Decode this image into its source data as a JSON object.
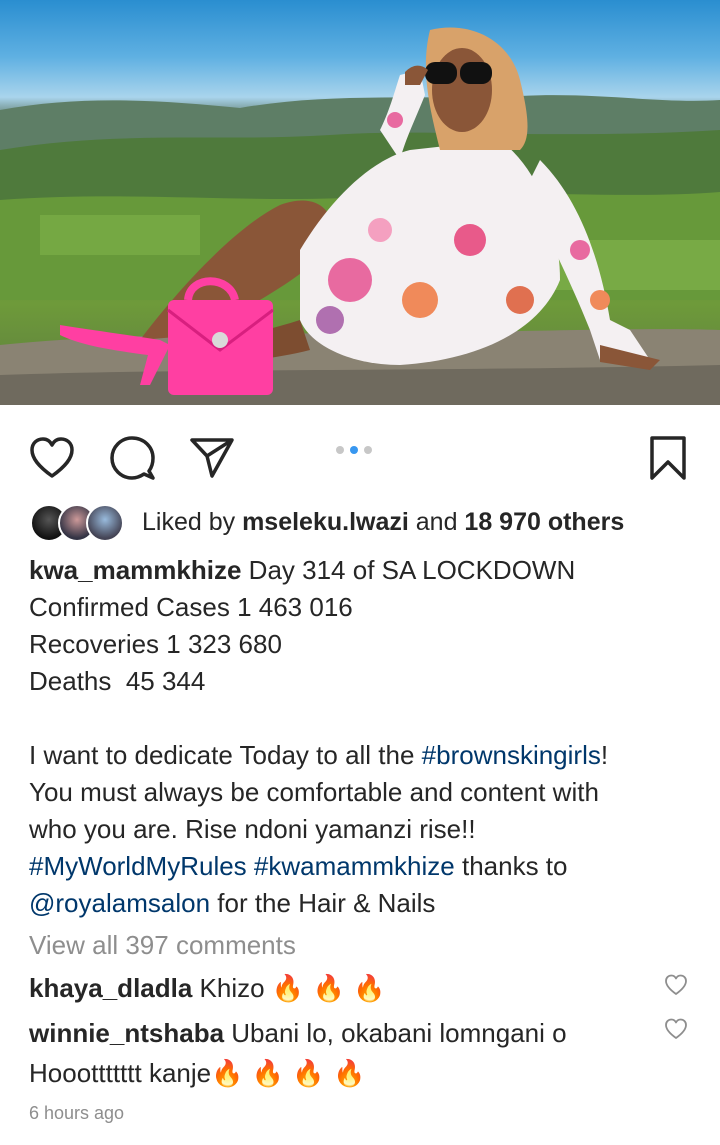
{
  "post": {
    "image_alt": "Woman in floral dress sitting on a rock with pink bag overlooking green valley",
    "carousel": {
      "count": 3,
      "active_index": 1
    }
  },
  "likes": {
    "prefix": "Liked by ",
    "user": "mseleku.lwazi",
    "middle": " and ",
    "others": "18 970 others"
  },
  "caption": {
    "author": "kwa_mammkhize",
    "line1_text": " Day 314 of SA LOCKDOWN",
    "line2": "Confirmed Cases 1 463 016",
    "line3": "Recoveries 1 323 680",
    "line4": "Deaths  45 344",
    "p2_line1_text": "I want to dedicate Today to all the ",
    "p2_line1_tag": "#brownskingirls",
    "p2_line1_end": "!",
    "p2_line2": "You must always be comfortable and content with",
    "p2_line3": "who you are. Rise ndoni yamanzi rise!!",
    "p2_line4_tag1": "#MyWorldMyRules",
    "p2_line4_space": " ",
    "p2_line4_tag2": "#kwamammkhize",
    "p2_line4_end": " thanks to",
    "p2_line5_tag": "@royalamsalon",
    "p2_line5_end": " for the Hair & Nails"
  },
  "view_all_comments": "View all 397 comments",
  "comments": [
    {
      "user": "khaya_dladla",
      "text": " Khizo ",
      "emoji": "🔥 🔥 🔥"
    },
    {
      "user": "winnie_ntshaba",
      "text": " Ubani lo, okabani lomngani o",
      "text2": "Hooottttttt kanje",
      "emoji": "🔥 🔥 🔥 🔥"
    }
  ],
  "timestamp": "6 hours ago",
  "colors": {
    "link": "#00376b",
    "muted": "#8e8e8e",
    "carousel_active": "#3897f0",
    "carousel_inactive": "#c7c7c7"
  },
  "icons": [
    "heart-icon",
    "comment-icon",
    "share-icon",
    "bookmark-icon",
    "small-heart-icon"
  ]
}
